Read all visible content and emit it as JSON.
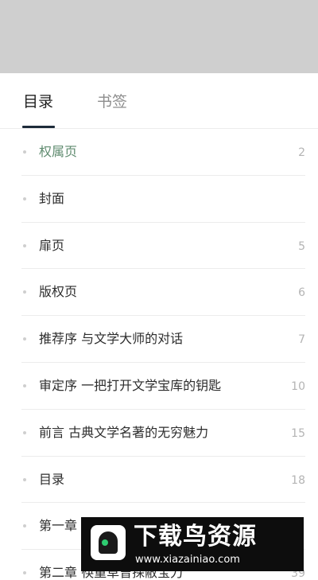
{
  "tabs": {
    "toc_label": "目录",
    "bookmarks_label": "书签"
  },
  "toc": [
    {
      "title": "权属页",
      "page": "2",
      "active": true
    },
    {
      "title": "封面",
      "page": ""
    },
    {
      "title": "扉页",
      "page": "5"
    },
    {
      "title": "版权页",
      "page": "6"
    },
    {
      "title": "推荐序 与文学大师的对话",
      "page": "7"
    },
    {
      "title": "审定序 一把打开文学宝库的钥匙",
      "page": "10"
    },
    {
      "title": "前言 古典文学名著的无穷魅力",
      "page": "15"
    },
    {
      "title": "目录",
      "page": "18"
    },
    {
      "title": "第一章",
      "page": ""
    },
    {
      "title": "第二章 筷重草曾探敝宝刀",
      "page": "39"
    }
  ],
  "watermark": {
    "title": "下载鸟资源",
    "url": "www.xiazainiao.com"
  },
  "colors": {
    "active_item": "#5f8b6f",
    "tab_underline": "#1d2b3a",
    "dim_overlay": "#cfcfcf"
  }
}
